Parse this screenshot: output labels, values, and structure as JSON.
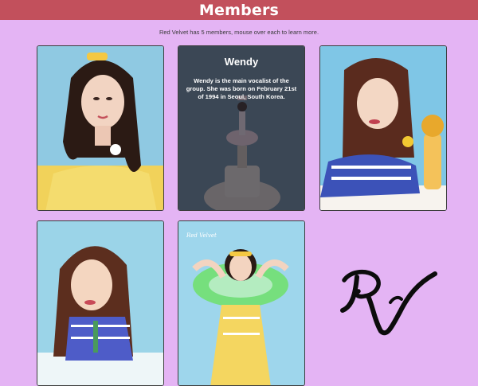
{
  "header": {
    "title": "Members"
  },
  "intro": {
    "text": "Red Velvet has 5 members, mouse over each to learn more."
  },
  "cards": [
    {
      "photo": "member-photo",
      "hovered": false
    },
    {
      "photo": "member-photo",
      "hovered": true,
      "name": "Wendy",
      "description": "Wendy is the main vocalist of the group. She was born on February 21st of 1994 in Seoul, South Korea."
    },
    {
      "photo": "member-photo",
      "hovered": false
    },
    {
      "photo": "member-photo",
      "hovered": false
    },
    {
      "photo": "member-photo",
      "hovered": false,
      "caption": "Red Velvet"
    }
  ],
  "logo": {
    "icon": "rv-logo-icon",
    "text": "RV"
  },
  "colors": {
    "background": "#e4b4f4",
    "header": "#c2505c",
    "overlay": "#1c1c26"
  }
}
